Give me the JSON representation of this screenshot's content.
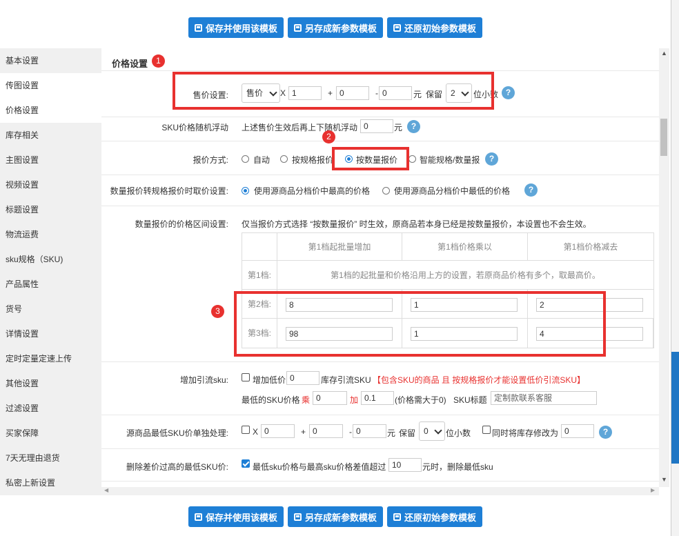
{
  "buttons": {
    "save_use": "保存并使用该模板",
    "save_new": "另存成新参数模板",
    "restore": "还原初始参数模板"
  },
  "sidebar": {
    "items": [
      "基本设置",
      "传图设置",
      "价格设置",
      "库存相关",
      "主图设置",
      "视频设置",
      "标题设置",
      "物流运费",
      "sku规格（SKU)",
      "产品属性",
      "货号",
      "详情设置",
      "定时定量定速上传",
      "其他设置",
      "过滤设置",
      "买家保障",
      "7天无理由退货",
      "私密上新设置"
    ]
  },
  "section": {
    "title": "价格设置"
  },
  "badges": [
    "1",
    "2",
    "3"
  ],
  "price": {
    "label": "售价设置:",
    "base_select": "售价",
    "x_sign": "X",
    "multiplier": "1",
    "plus_sign": "+",
    "add": "0",
    "minus_sign": "-",
    "subtract": "0",
    "unit": "元",
    "keep_label": "保留",
    "decimals": "2",
    "decimals_suffix": "位小数"
  },
  "random_float": {
    "label": "SKU价格随机浮动",
    "desc": "上述售价生效后再上下随机浮动",
    "value": "0",
    "unit": "元"
  },
  "quote_mode": {
    "label": "报价方式:",
    "options": [
      "自动",
      "按规格报价",
      "按数量报价",
      "智能规格/数量报"
    ],
    "selected": "按数量报价"
  },
  "convert": {
    "label": "数量报价转规格报价时取价设置:",
    "options": [
      "使用源商品分档价中最高的价格",
      "使用源商品分档价中最低的价格"
    ],
    "selected": "使用源商品分档价中最高的价格"
  },
  "tiers": {
    "label": "数量报价的价格区间设置:",
    "note": "仅当报价方式选择 “按数量报价” 时生效，原商品若本身已经是按数量报价，本设置也不会生效。",
    "headers": [
      "第1档起批量增加",
      "第1档价格乘以",
      "第1档价格减去"
    ],
    "tier1_label": "第1档:",
    "tier1_note": "第1档的起批量和价格沿用上方的设置，若原商品价格有多个，取最高价。",
    "tier2_label": "第2档:",
    "tier2_values": [
      "8",
      "1",
      "2"
    ],
    "tier3_label": "第3档:",
    "tier3_values": [
      "98",
      "1",
      "4"
    ]
  },
  "traffic_sku": {
    "label": "增加引流sku:",
    "check_label": "增加低价",
    "value": "0",
    "suffix": "库存引流SKU",
    "warn": "【包含SKU的商品 且 按规格报价才能设置低价引流SKU】",
    "min_label": "最低的SKU价格",
    "mul_label": "乘",
    "mul_value": "0",
    "add_label": "加",
    "add_value": "0.1",
    "hint": "(价格需大于0)",
    "title_label": "SKU标题",
    "title_placeholder": "定制款联系客服"
  },
  "min_sku": {
    "label": "源商品最低SKU价单独处理:",
    "x_sign": "X",
    "multiplier": "0",
    "plus_sign": "+",
    "add": "0",
    "minus_sign": "-",
    "subtract": "0",
    "unit": "元",
    "keep_label": "保留",
    "decimals": "0",
    "decimals_suffix": "位小数",
    "stock_label": "同时将库存修改为",
    "stock_value": "0"
  },
  "delete_high": {
    "label": "删除差价过高的最低SKU价:",
    "text_before": "最低sku价格与最高sku价格差值超过",
    "value": "10",
    "text_after": "元时，删除最低sku"
  },
  "colors": {
    "accent": "#1e7fd6",
    "highlight": "#e8312f",
    "help": "#5fa6d8"
  }
}
